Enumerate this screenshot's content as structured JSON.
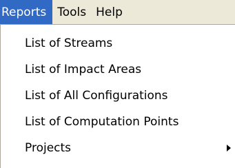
{
  "menubar": {
    "items": [
      {
        "label": "Reports"
      },
      {
        "label": "Tools"
      },
      {
        "label": "Help"
      }
    ]
  },
  "dropdown": {
    "items": [
      {
        "label": "List of Streams"
      },
      {
        "label": "List of Impact Areas"
      },
      {
        "label": "List of All Configurations"
      },
      {
        "label": "List of Computation Points"
      },
      {
        "label": "Projects"
      }
    ]
  },
  "colors": {
    "menubar_bg": "#ece9d8",
    "active_menu_bg": "#316ac5",
    "dropdown_bg": "#ffffff"
  },
  "icons": {
    "submenu_indicator": "chevron-right-icon"
  }
}
